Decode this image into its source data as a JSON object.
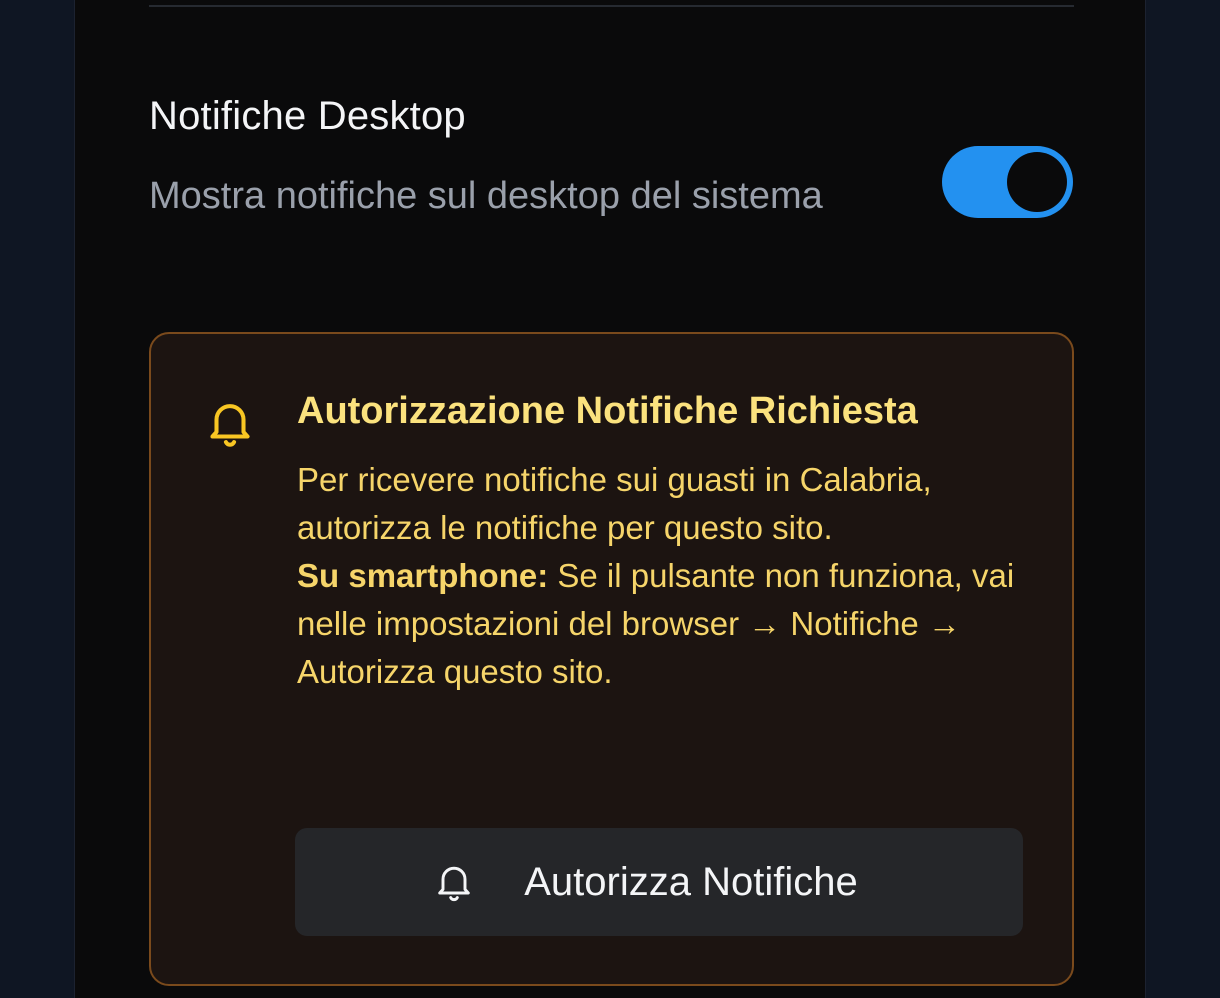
{
  "setting": {
    "title": "Notifiche Desktop",
    "description": "Mostra notifiche sul desktop del sistema",
    "enabled": true
  },
  "alert": {
    "icon": "bell-icon",
    "title": "Autorizzazione Notifiche Richiesta",
    "paragraph1": "Per ricevere notifiche sui guasti in Calabria, autorizza le notifiche per questo sito.",
    "smartphone_label": "Su smartphone:",
    "paragraph2": " Se il pulsante non funziona, vai nelle impostazioni del browser → Notifiche → Autorizza questo sito.",
    "button_label": "Autorizza Notifiche",
    "button_icon": "bell-icon"
  },
  "colors": {
    "toggle_on": "#2391f0",
    "alert_border": "#7a4a1c",
    "alert_bg": "#1c1411",
    "alert_text": "#f6d56a",
    "alert_title": "#fbe27e",
    "bell_icon": "#f8c623"
  }
}
